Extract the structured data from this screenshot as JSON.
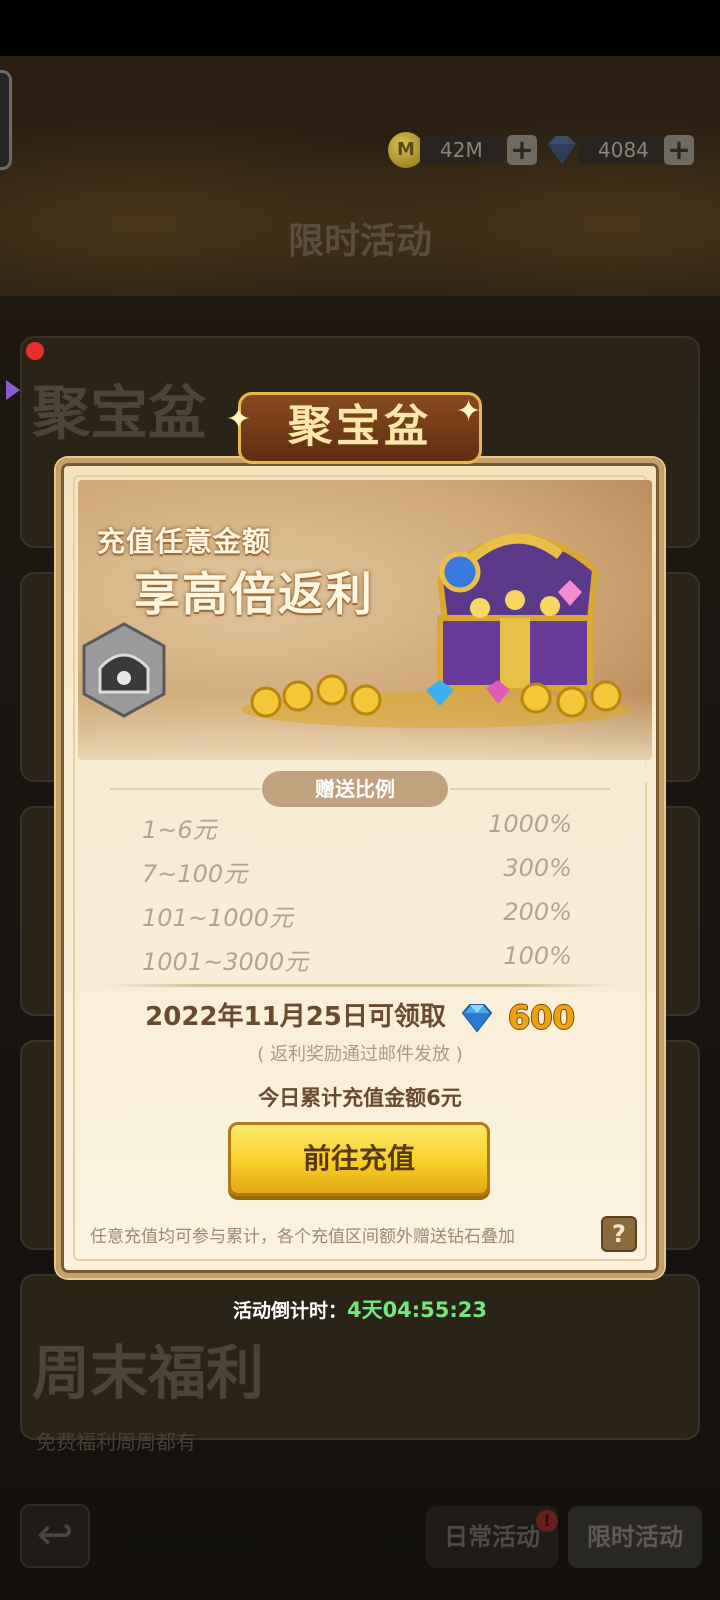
{
  "header": {
    "title": "限时活动",
    "coins": "42M",
    "gems": "4084",
    "coin_symbol": "M"
  },
  "background_cards": [
    {
      "title": "聚宝盆"
    },
    {
      "title": "周末福利",
      "subtitle": "免费福利周周都有"
    }
  ],
  "popup": {
    "ribbon_title": "聚宝盆",
    "slogan_line1": "充值任意金额",
    "slogan_line2": "享高倍返利",
    "ratio_header": "赠送比例",
    "ratios": [
      {
        "range": "1~6元",
        "percent": "1000%"
      },
      {
        "range": "7~100元",
        "percent": "300%"
      },
      {
        "range": "101~1000元",
        "percent": "200%"
      },
      {
        "range": "1001~3000元",
        "percent": "100%"
      }
    ],
    "claim_text": "2022年11月25日可领取",
    "claim_amount": "600",
    "mail_note": "( 返利奖励通过邮件发放 )",
    "today_total": "今日累计充值金额6元",
    "go_button": "前往充值",
    "footnote": "任意充值均可参与累计，各个充值区间额外赠送钻石叠加",
    "help": "?"
  },
  "countdown": {
    "label": "活动倒计时：",
    "time": "4天04:55:23"
  },
  "bottom_bar": {
    "tab_daily": "日常活动",
    "tab_limited": "限时活动",
    "badge": "!"
  },
  "colors": {
    "accent_gold": "#f7cf28",
    "countdown_green": "#72e87a",
    "amount_orange": "#f0a010"
  }
}
